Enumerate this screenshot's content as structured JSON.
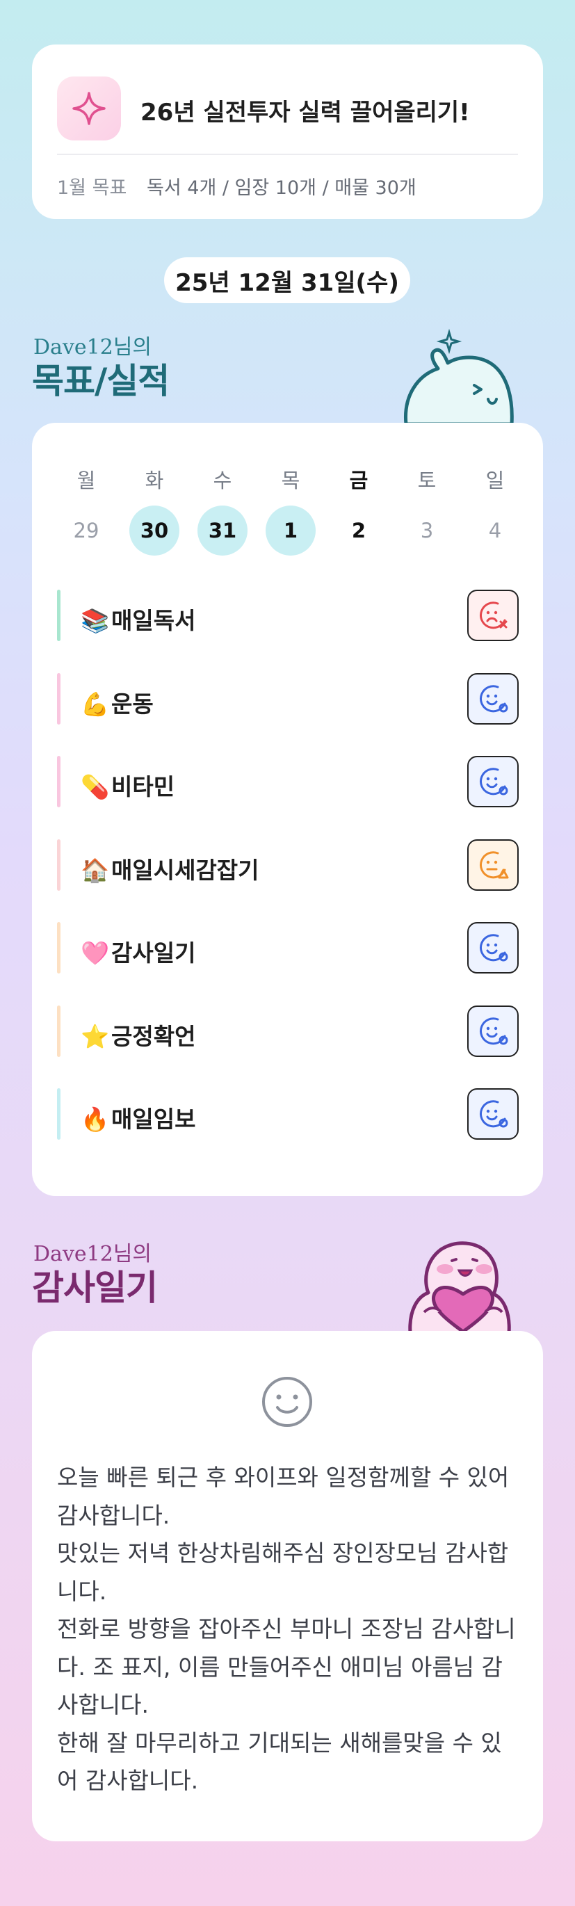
{
  "goal": {
    "title": "26년 실전투자 실력 끌어올리기!",
    "month_label": "1월 목표",
    "items": "독서 4개 / 임장 10개 / 매물 30개",
    "icon": "sparkle-icon"
  },
  "date_label": "25년 12월 31일(수)",
  "section_goals": {
    "sub": "Dave12님의",
    "title": "목표/실적"
  },
  "week": {
    "days": [
      {
        "dow": "월",
        "num": "29",
        "state": "none"
      },
      {
        "dow": "화",
        "num": "30",
        "state": "done"
      },
      {
        "dow": "수",
        "num": "31",
        "state": "done"
      },
      {
        "dow": "목",
        "num": "1",
        "state": "done"
      },
      {
        "dow": "금",
        "num": "2",
        "state": "today"
      },
      {
        "dow": "토",
        "num": "3",
        "state": "none"
      },
      {
        "dow": "일",
        "num": "4",
        "state": "none"
      }
    ]
  },
  "habits": [
    {
      "emoji": "📚",
      "label": "매일독서",
      "status": "fail",
      "bar_color": "#a8e6cf"
    },
    {
      "emoji": "💪",
      "label": "운동",
      "status": "done",
      "bar_color": "#f9c6df"
    },
    {
      "emoji": "💊",
      "label": "비타민",
      "status": "done",
      "bar_color": "#f9c6df"
    },
    {
      "emoji": "🏠",
      "label": "매일시세감잡기",
      "status": "warn",
      "bar_color": "#fad4d6"
    },
    {
      "emoji": "🩷",
      "label": "감사일기",
      "status": "done",
      "bar_color": "#fde0c2"
    },
    {
      "emoji": "⭐",
      "label": "긍정확언",
      "status": "done",
      "bar_color": "#fde0c2"
    },
    {
      "emoji": "🔥",
      "label": "매일임보",
      "status": "done",
      "bar_color": "#c4eef2"
    }
  ],
  "section_thanks": {
    "sub": "Dave12님의",
    "title": "감사일기"
  },
  "thanks": {
    "lines": [
      "오늘 빠른 퇴근 후 와이프와 일정함께할 수 있어 감사합니다.",
      "맛있는 저녁 한상차림해주심 장인장모님 감사합니다.",
      "전화로 방향을 잡아주신 부마니 조장님 감사합니다. 조 표지, 이름 만들어주신 애미님 아름님 감사합니다.",
      "한해 잘 마무리하고 기대되는 새해를맞을 수 있어 감사합니다."
    ]
  },
  "colors": {
    "accent_teal": "#1f6b78",
    "accent_plum": "#7a2a6e",
    "done_blue": "#3b66e0",
    "fail_red": "#e5484d",
    "warn_orange": "#f0902a"
  }
}
